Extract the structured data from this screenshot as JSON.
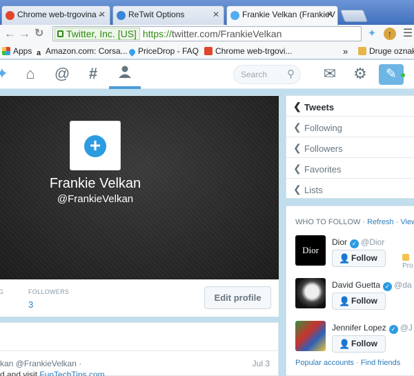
{
  "browser": {
    "tabs": [
      {
        "title": "Chrome web-trgovina -",
        "icon_color": "#e0462c"
      },
      {
        "title": "ReTwit Options",
        "icon_color": "#3a86d6"
      },
      {
        "title": "Frankie Velkan (FrankieV",
        "icon_color": "#55acee"
      }
    ],
    "ssl_label": "Twitter, Inc. [US]",
    "url_scheme": "https://",
    "url_rest": "twitter.com/FrankieVelkan",
    "bookmarks": [
      {
        "label": "Apps",
        "icon": "apps-grid-icon",
        "color": "#e0462c"
      },
      {
        "label": "Amazon.com: Corsa...",
        "icon": "amazon-icon",
        "color": "#222"
      },
      {
        "label": "PriceDrop - FAQ",
        "icon": "drop-icon",
        "color": "#3aa0e8"
      },
      {
        "label": "Chrome web-trgovi...",
        "icon": "chrome-store-icon",
        "color": "#e0462c"
      },
      {
        "label": "»",
        "icon": "",
        "color": ""
      },
      {
        "label": "Druge oznake",
        "icon": "folder-icon",
        "color": "#e7b64a"
      }
    ]
  },
  "twitter": {
    "nav": {
      "home_icon": "home-icon",
      "connect_icon": "at-icon",
      "discover_icon": "hash-icon",
      "me_icon": "person-icon"
    },
    "search_placeholder": "Search",
    "accent_color": "#55acee"
  },
  "profile": {
    "name": "Frankie Velkan",
    "handle": "@FrankieVelkan",
    "stats": [
      {
        "label": "G",
        "value": ""
      },
      {
        "label": "FOLLOWERS",
        "value": "3"
      }
    ],
    "edit_button": "Edit profile"
  },
  "tweet": {
    "author": "kan @FrankieVelkan ·",
    "date": "Jul 3",
    "text_prefix": "d and visit ",
    "text_link": "FunTechTips.com"
  },
  "sidenav": {
    "items": [
      {
        "label": "Tweets",
        "active": true
      },
      {
        "label": "Following",
        "active": false
      },
      {
        "label": "Followers",
        "active": false
      },
      {
        "label": "Favorites",
        "active": false
      },
      {
        "label": "Lists",
        "active": false
      }
    ]
  },
  "who_to_follow": {
    "title": "WHO TO FOLLOW ·",
    "refresh": "Refresh",
    "sep": "·",
    "view_all": "View a",
    "follow_label": "Follow",
    "promoted_label": "Pro",
    "accounts": [
      {
        "name": "Dior",
        "handle": "@Dior",
        "avatar_text": "Dior"
      },
      {
        "name": "David Guetta",
        "handle": "@da",
        "avatar_text": ""
      },
      {
        "name": "Jennifer Lopez",
        "handle": "@J",
        "avatar_text": ""
      }
    ],
    "footer_popular": "Popular accounts",
    "footer_sep": "·",
    "footer_find": "Find friends"
  }
}
